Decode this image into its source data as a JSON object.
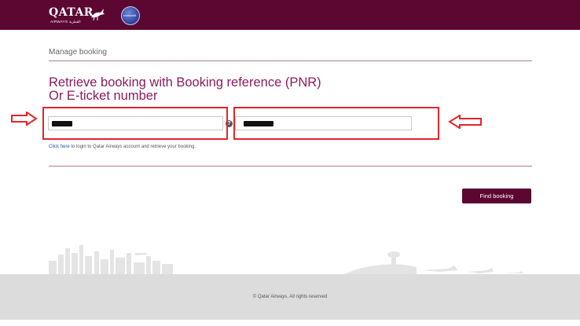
{
  "header": {
    "logo_text": "QATAR",
    "logo_subtext": "AIRWAYS القطرية",
    "alliance_badge": "oneworld",
    "bar_color": "#5c0632"
  },
  "section": {
    "label": "Manage booking"
  },
  "heading": {
    "line1": "Retrieve booking with Booking reference (PNR)",
    "line2": "Or E-ticket number"
  },
  "form": {
    "booking_reference": {
      "value": ""
    },
    "last_name": {
      "value": ""
    },
    "help_symbol": "?",
    "login_link_text": "Click here",
    "login_rest_text": " to login to Qatar Airways account and retrieve your booking."
  },
  "actions": {
    "find_booking_label": "Find booking"
  },
  "footer": {
    "copyright": "© Qatar Airways. All rights reserved"
  },
  "colors": {
    "accent": "#5c0632",
    "heading": "#8c1b5c",
    "annotation_red": "#e1262b"
  }
}
